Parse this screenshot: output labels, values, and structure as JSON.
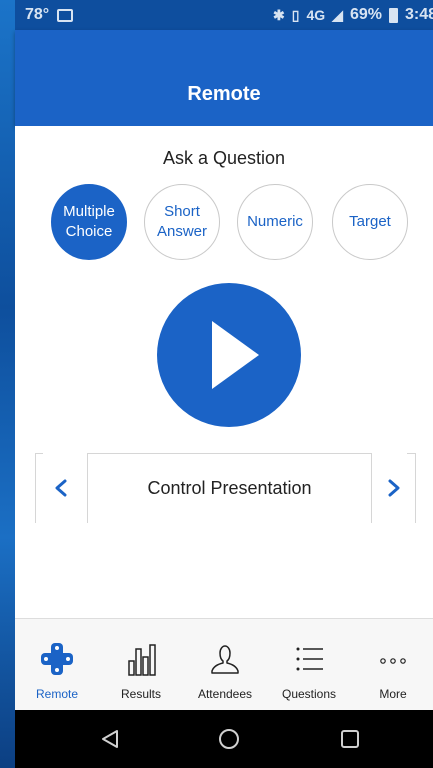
{
  "status_bar": {
    "temperature": "78°",
    "network": "4G",
    "battery_percent": "69%",
    "time": "3:48"
  },
  "app_bar": {
    "title": "Remote"
  },
  "ask_question": {
    "title": "Ask a Question",
    "question_types": [
      {
        "label": "Multiple\nChoice",
        "selected": true
      },
      {
        "label": "Short\nAnswer",
        "selected": false
      },
      {
        "label": "Numeric",
        "selected": false
      },
      {
        "label": "Target",
        "selected": false
      }
    ]
  },
  "control": {
    "label": "Control Presentation"
  },
  "tabs": [
    {
      "label": "Remote",
      "icon": "remote-dpad-icon",
      "active": true
    },
    {
      "label": "Results",
      "icon": "bar-chart-icon",
      "active": false
    },
    {
      "label": "Attendees",
      "icon": "person-icon",
      "active": false
    },
    {
      "label": "Questions",
      "icon": "list-icon",
      "active": false
    },
    {
      "label": "More",
      "icon": "more-dots-icon",
      "active": false
    }
  ],
  "colors": {
    "accent": "#1b63c6",
    "status_bar": "#0e4e9e",
    "tab_bar": "#f7f7f7",
    "nav_bar": "#000000"
  }
}
